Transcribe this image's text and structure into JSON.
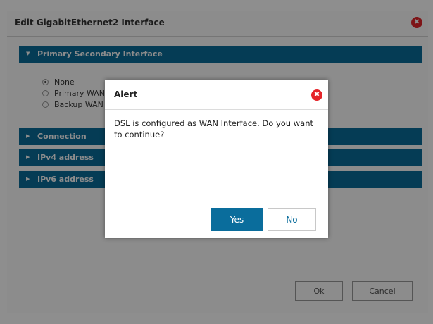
{
  "edit_dialog": {
    "title": "Edit GigabitEthernet2 Interface",
    "close_glyph": "✖",
    "sections": [
      {
        "label": "Primary Secondary Interface",
        "caret": "▼"
      },
      {
        "label": "Connection",
        "caret": "▶"
      },
      {
        "label": "IPv4 address",
        "caret": "▶"
      },
      {
        "label": "IPv6 address",
        "caret": "▶"
      }
    ],
    "radio_options": [
      {
        "label": "None",
        "checked": true
      },
      {
        "label": "Primary WAN",
        "checked": false
      },
      {
        "label": "Backup WAN",
        "checked": false
      }
    ],
    "ok_label": "Ok",
    "cancel_label": "Cancel"
  },
  "alert": {
    "title": "Alert",
    "close_glyph": "✖",
    "message": "DSL is configured as WAN Interface. Do you want to continue?",
    "yes_label": "Yes",
    "no_label": "No"
  },
  "colors": {
    "accent": "#0a6d9c",
    "close_red": "#e5252a"
  }
}
